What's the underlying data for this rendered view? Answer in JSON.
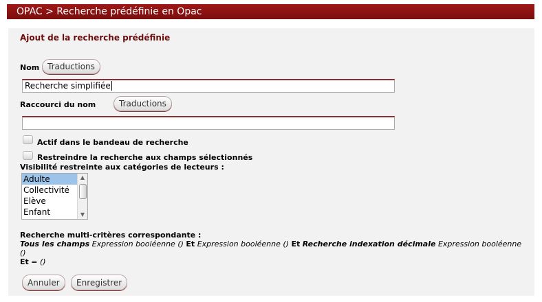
{
  "header": {
    "title": "OPAC > Recherche prédéfinie en Opac"
  },
  "form": {
    "section_title": "Ajout de la recherche prédéfinie",
    "nom_label": "Nom",
    "translations_button": "Traductions",
    "nom_value": "Recherche simplifiée",
    "raccourci_label": "Raccourci du nom",
    "raccourci_value": "",
    "actif_label": "Actif dans le bandeau de recherche",
    "restreindre_label": "Restreindre la recherche aux champs sélectionnés",
    "visibilite_label": "Visibilité restreinte aux catégories de lecteurs :",
    "categories": [
      "Adulte",
      "Collectivité",
      "Elève",
      "Enfant"
    ],
    "selected_category": "Adulte",
    "multi_title": "Recherche multi-critères correspondante :",
    "multi": {
      "tous": "Tous les champs",
      "expr1": "Expression booléenne ()",
      "et1": "Et",
      "expr2": "Expression booléenne ()",
      "et2": "Et",
      "recherche_idx": "Recherche indexation décimale",
      "expr3": "Expression booléenne ()",
      "et3": "Et",
      "eq": "= ()"
    },
    "cancel_label": "Annuler",
    "save_label": "Enregistrer"
  }
}
